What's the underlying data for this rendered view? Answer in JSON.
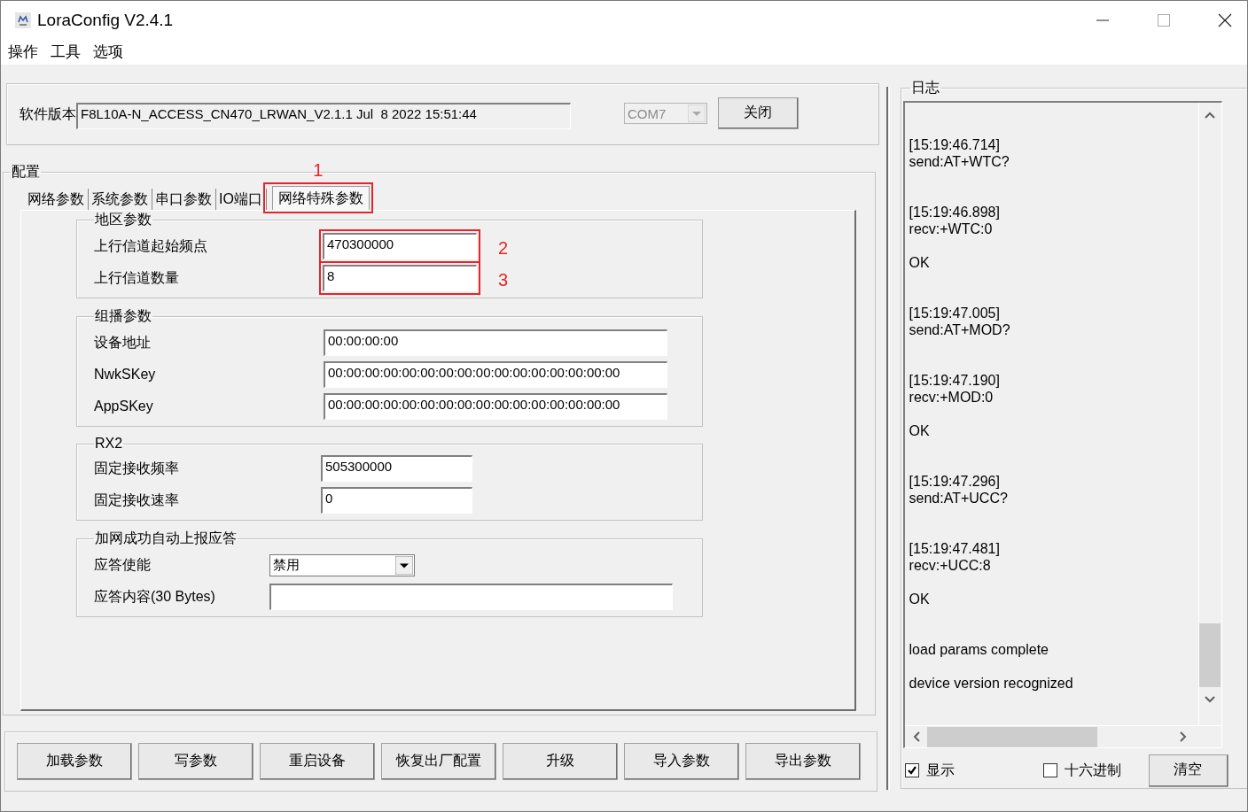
{
  "window": {
    "title": "LoraConfig V2.4.1"
  },
  "menu": [
    "操作",
    "工具",
    "选项"
  ],
  "version": {
    "label": "软件版本",
    "value": "F8L10A-N_ACCESS_CN470_LRWAN_V2.1.1 Jul  8 2022 15:51:44",
    "port": {
      "value": "COM7",
      "disabled": true
    },
    "button": "关闭"
  },
  "config": {
    "title": "配置",
    "tabs": [
      {
        "label": "网络参数",
        "selected": false
      },
      {
        "label": "系统参数",
        "selected": false
      },
      {
        "label": "串口参数",
        "selected": false
      },
      {
        "label": "IO端口",
        "selected": false
      },
      {
        "label": "网络特殊参数",
        "selected": true,
        "annotation": {
          "label": "1"
        }
      }
    ],
    "groups": [
      {
        "title": "地区参数",
        "fields": [
          {
            "kind": "text",
            "label": "上行信道起始频点",
            "value": "470300000",
            "annotation": {
              "label": "2"
            }
          },
          {
            "kind": "text",
            "label": "上行信道数量",
            "value": "8",
            "annotation": {
              "label": "3"
            }
          }
        ]
      },
      {
        "title": "组播参数",
        "fields": [
          {
            "kind": "text",
            "label": "设备地址",
            "value": "00:00:00:00"
          },
          {
            "kind": "text",
            "label": "NwkSKey",
            "value": "00:00:00:00:00:00:00:00:00:00:00:00:00:00:00:00"
          },
          {
            "kind": "text",
            "label": "AppSKey",
            "value": "00:00:00:00:00:00:00:00:00:00:00:00:00:00:00:00"
          }
        ]
      },
      {
        "title": "RX2",
        "fields": [
          {
            "kind": "text",
            "label": "固定接收频率",
            "value": "505300000"
          },
          {
            "kind": "text",
            "label": "固定接收速率",
            "value": "0"
          }
        ]
      },
      {
        "title": "加网成功自动上报应答",
        "fields": [
          {
            "kind": "select",
            "label": "应答使能",
            "value": "禁用"
          },
          {
            "kind": "text",
            "label": "应答内容(30 Bytes)"
          }
        ]
      }
    ]
  },
  "buttons": [
    "加载参数",
    "写参数",
    "重启设备",
    "恢复出厂配置",
    "升级",
    "导入参数",
    "导出参数"
  ],
  "log": {
    "title": "日志",
    "entries": [
      {
        "kind": "send",
        "time": "[15:19:46.714]",
        "text": "send:AT+WTC?"
      },
      {
        "kind": "recv",
        "time": "[15:19:46.898]",
        "text": "recv:+WTC:0",
        "status": "OK"
      },
      {
        "kind": "send",
        "time": "[15:19:47.005]",
        "text": "send:AT+MOD?"
      },
      {
        "kind": "recv",
        "time": "[15:19:47.190]",
        "text": "recv:+MOD:0",
        "status": "OK"
      },
      {
        "kind": "send",
        "time": "[15:19:47.296]",
        "text": "send:AT+UCC?"
      },
      {
        "kind": "recv",
        "time": "[15:19:47.481]",
        "text": "recv:+UCC:8",
        "status": "OK"
      },
      {
        "kind": "info",
        "text": "load params complete"
      },
      {
        "kind": "info",
        "text": "device version recognized"
      }
    ],
    "show": {
      "label": "显示",
      "checked": true
    },
    "hex": {
      "label": "十六进制",
      "checked": false
    },
    "clear": "清空"
  }
}
